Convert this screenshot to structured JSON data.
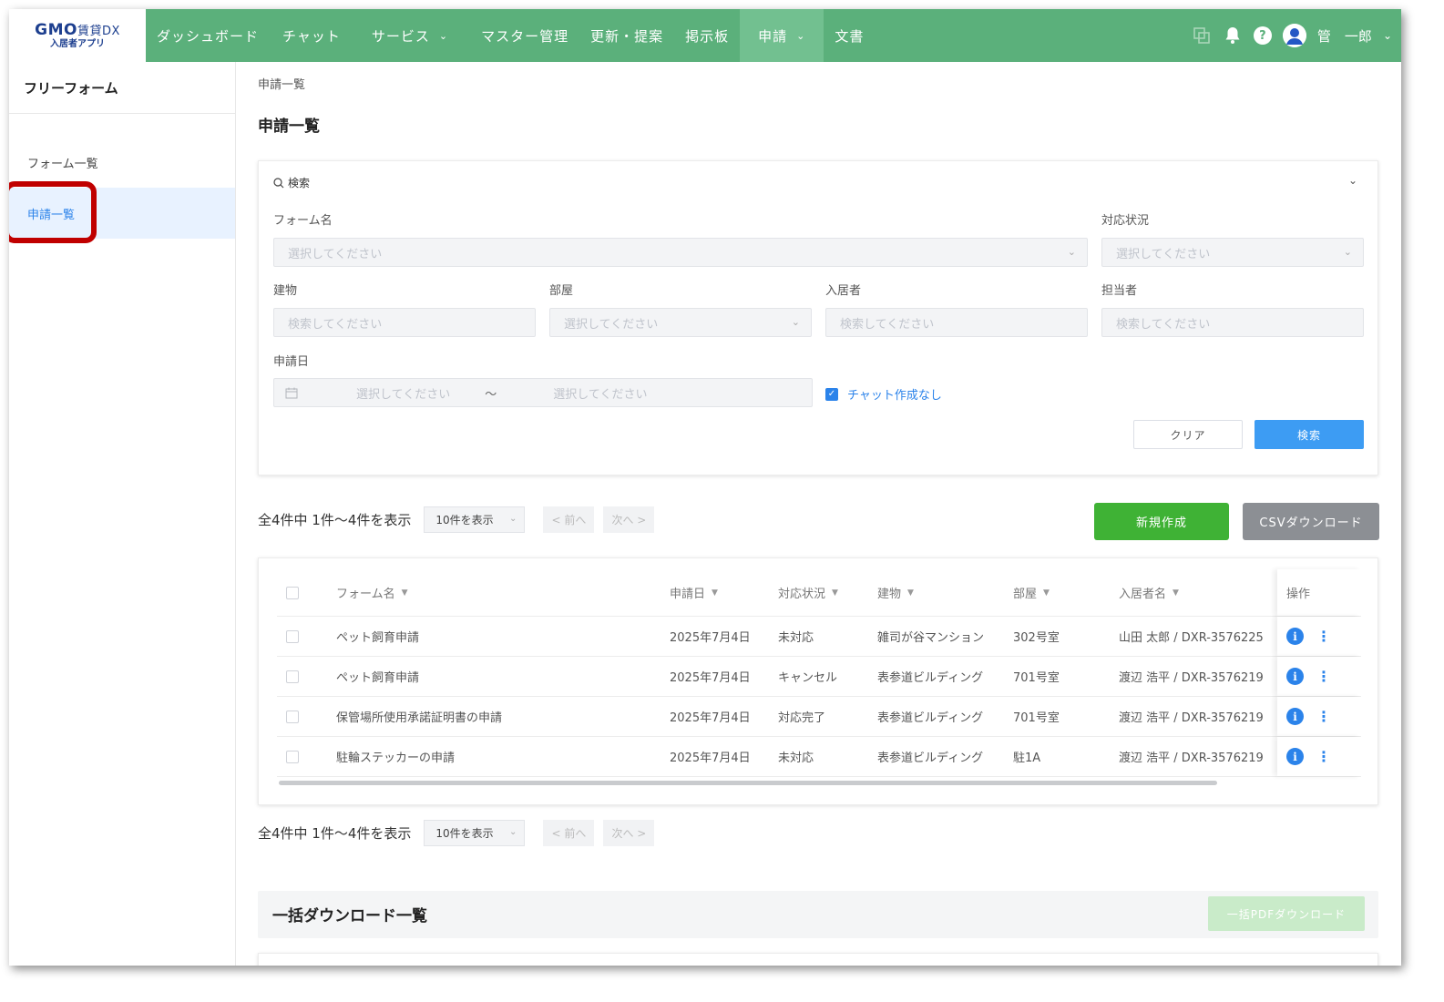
{
  "header": {
    "logo_main": "GMO",
    "logo_sub": "賃貸DX",
    "logo_app": "入居者アプリ",
    "nav": [
      {
        "label": "ダッシュボード"
      },
      {
        "label": "チャット"
      },
      {
        "label": "サービス"
      },
      {
        "label": "マスター管理"
      },
      {
        "label": "更新・提案"
      },
      {
        "label": "掲示板"
      },
      {
        "label": "申請"
      },
      {
        "label": "文書"
      }
    ],
    "user_name": "管　一郎",
    "help_glyph": "?"
  },
  "sidebar": {
    "title": "フリーフォーム",
    "items": [
      {
        "label": "フォーム一覧"
      },
      {
        "label": "申請一覧"
      }
    ]
  },
  "main": {
    "breadcrumb": "申請一覧",
    "title": "申請一覧"
  },
  "search": {
    "header": "検索",
    "form_name_label": "フォーム名",
    "form_name_placeholder": "選択してください",
    "status_label": "対応状況",
    "status_placeholder": "選択してください",
    "building_label": "建物",
    "building_placeholder": "検索してください",
    "room_label": "部屋",
    "room_placeholder": "選択してください",
    "resident_label": "入居者",
    "resident_placeholder": "検索してください",
    "staff_label": "担当者",
    "staff_placeholder": "検索してください",
    "date_label": "申請日",
    "date_start_placeholder": "選択してください",
    "date_separator": "〜",
    "date_end_placeholder": "選択してください",
    "no_chat_label": "チャット作成なし",
    "no_chat_checked": true,
    "clear_label": "クリア",
    "search_label": "検索"
  },
  "pager": {
    "summary": "全4件中 1件〜4件を表示",
    "page_size": "10件を表示",
    "prev": "< 前へ",
    "next": "次へ >"
  },
  "actions": {
    "new_label": "新規作成",
    "csv_label": "CSVダウンロード"
  },
  "table": {
    "columns": [
      "フォーム名",
      "申請日",
      "対応状況",
      "建物",
      "部屋",
      "入居者名",
      "操作"
    ],
    "rows": [
      {
        "form": "ペット飼育申請",
        "date": "2025年7月4日",
        "status": "未対応",
        "building": "雑司が谷マンション",
        "room": "302号室",
        "resident": "山田 太郎 / DXR-3576225"
      },
      {
        "form": "ペット飼育申請",
        "date": "2025年7月4日",
        "status": "キャンセル",
        "building": "表参道ビルディング",
        "room": "701号室",
        "resident": "渡辺 浩平 / DXR-3576219"
      },
      {
        "form": "保管場所使用承諾証明書の申請",
        "date": "2025年7月4日",
        "status": "対応完了",
        "building": "表参道ビルディング",
        "room": "701号室",
        "resident": "渡辺 浩平 / DXR-3576219"
      },
      {
        "form": "駐輪ステッカーの申請",
        "date": "2025年7月4日",
        "status": "未対応",
        "building": "表参道ビルディング",
        "room": "駐1A",
        "resident": "渡辺 浩平 / DXR-3576219"
      }
    ]
  },
  "bulk": {
    "title": "一括ダウンロード一覧",
    "pdf_label": "一括PDFダウンロード"
  },
  "colors": {
    "header_bg": "#5bb07b",
    "active_nav": "#72c090",
    "accent_blue": "#2b83ea",
    "new_button": "#3fb235",
    "csv_button": "#8c8f94",
    "highlight_border": "#c00000"
  }
}
